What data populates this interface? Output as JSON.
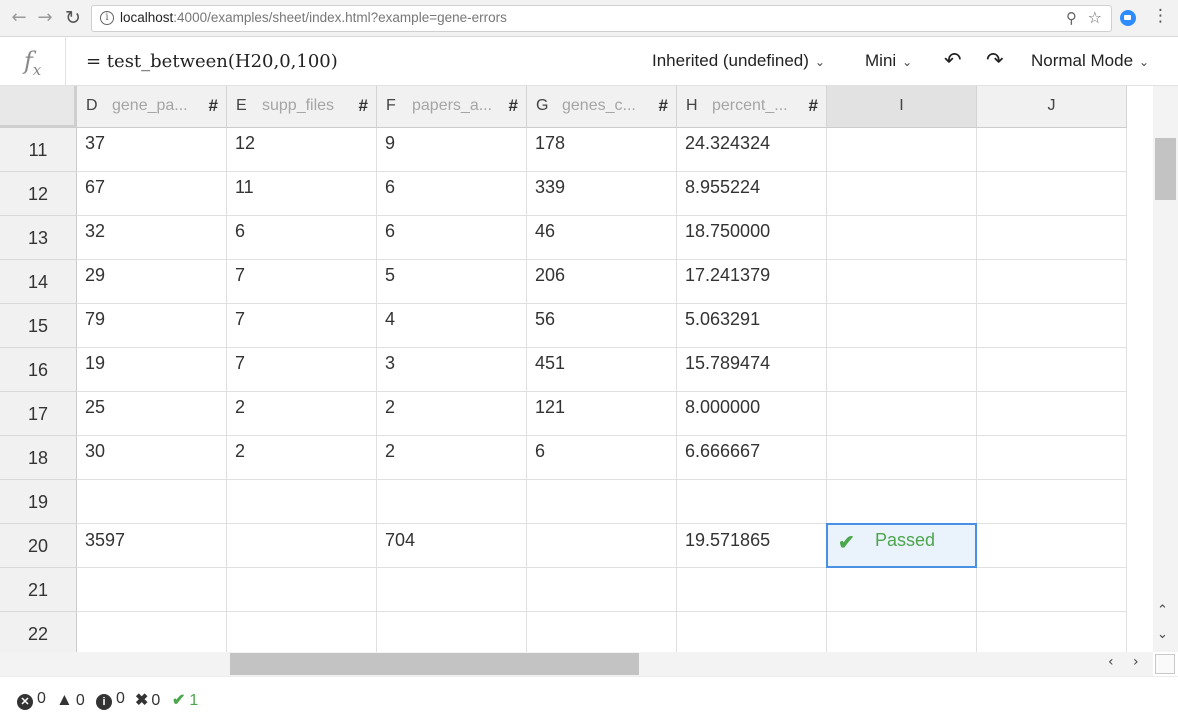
{
  "browser": {
    "url_host": "localhost",
    "url_rest": ":4000/examples/sheet/index.html?example=gene-errors"
  },
  "toolbar": {
    "formula": "= test_between(H20,0,100)",
    "type_label": "Inherited (undefined)",
    "view_label": "Mini",
    "mode_label": "Normal Mode"
  },
  "columns": [
    {
      "letter": "D",
      "name": "gene_pa...",
      "type_icon": "#"
    },
    {
      "letter": "E",
      "name": "supp_files",
      "type_icon": "#"
    },
    {
      "letter": "F",
      "name": "papers_a...",
      "type_icon": "#"
    },
    {
      "letter": "G",
      "name": "genes_c...",
      "type_icon": "#"
    },
    {
      "letter": "H",
      "name": "percent_...",
      "type_icon": "#"
    },
    {
      "letter": "I",
      "name": "",
      "type_icon": ""
    },
    {
      "letter": "J",
      "name": "",
      "type_icon": ""
    }
  ],
  "rows": [
    {
      "num": "11",
      "cells": [
        "37",
        "12",
        "9",
        "178",
        "24.324324",
        "",
        ""
      ]
    },
    {
      "num": "12",
      "cells": [
        "67",
        "11",
        "6",
        "339",
        "8.955224",
        "",
        ""
      ]
    },
    {
      "num": "13",
      "cells": [
        "32",
        "6",
        "6",
        "46",
        "18.750000",
        "",
        ""
      ]
    },
    {
      "num": "14",
      "cells": [
        "29",
        "7",
        "5",
        "206",
        "17.241379",
        "",
        ""
      ]
    },
    {
      "num": "15",
      "cells": [
        "79",
        "7",
        "4",
        "56",
        "5.063291",
        "",
        ""
      ]
    },
    {
      "num": "16",
      "cells": [
        "19",
        "7",
        "3",
        "451",
        "15.789474",
        "",
        ""
      ]
    },
    {
      "num": "17",
      "cells": [
        "25",
        "2",
        "2",
        "121",
        "8.000000",
        "",
        ""
      ]
    },
    {
      "num": "18",
      "cells": [
        "30",
        "2",
        "2",
        "6",
        "6.666667",
        "",
        ""
      ]
    },
    {
      "num": "19",
      "cells": [
        "",
        "",
        "",
        "",
        "",
        "",
        ""
      ]
    },
    {
      "num": "20",
      "cells": [
        "3597",
        "",
        "704",
        "",
        "19.571865",
        "",
        ""
      ]
    },
    {
      "num": "21",
      "cells": [
        "",
        "",
        "",
        "",
        "",
        "",
        ""
      ]
    },
    {
      "num": "22",
      "cells": [
        "",
        "",
        "",
        "",
        "",
        "",
        ""
      ]
    }
  ],
  "selected_cell": {
    "ref": "I20",
    "label": "Passed",
    "icon": "check-icon",
    "color": "#4ca64c"
  },
  "status": {
    "errors": "0",
    "warnings": "0",
    "info": "0",
    "failed": "0",
    "passed": "1"
  },
  "colors": {
    "accent": "#4a90e2",
    "success": "#4ca64c"
  }
}
